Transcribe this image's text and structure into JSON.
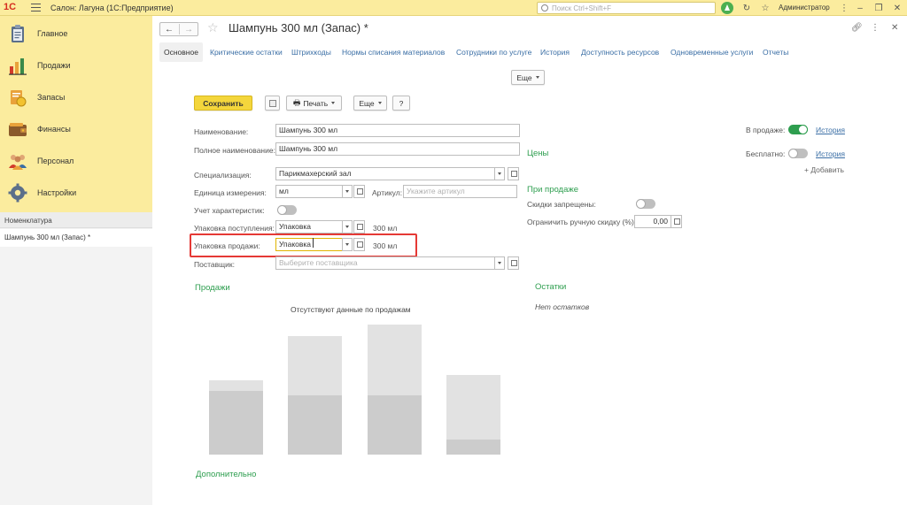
{
  "topbar": {
    "logo": "1С",
    "app_title": "Салон: Лагуна  (1С:Предприятие)",
    "search_placeholder": "Поиск Ctrl+Shift+F",
    "user": "Администратор"
  },
  "sidebar": {
    "items": [
      {
        "label": "Главное",
        "icon": "clipboard-icon"
      },
      {
        "label": "Продажи",
        "icon": "bar-chart-icon"
      },
      {
        "label": "Запасы",
        "icon": "coins-icon"
      },
      {
        "label": "Финансы",
        "icon": "wallet-icon"
      },
      {
        "label": "Персонал",
        "icon": "people-icon"
      },
      {
        "label": "Настройки",
        "icon": "gear-icon"
      }
    ],
    "section_title": "Номенклатура",
    "open_item": "Шампунь 300 мл (Запас) *"
  },
  "window": {
    "title": "Шампунь 300 мл (Запас) *"
  },
  "tabs": [
    "Основное",
    "Критические остатки",
    "Штрихкоды",
    "Нормы списания материалов",
    "Сотрудники по услуге",
    "История",
    "Доступность ресурсов",
    "Одновременные услуги",
    "Отчеты"
  ],
  "toolbar": {
    "more_top": "Еще",
    "save": "Сохранить",
    "print": "Печать",
    "more": "Еще",
    "help": "?"
  },
  "form": {
    "name_label": "Наименование:",
    "name_value": "Шампунь 300 мл",
    "fullname_label": "Полное наименование:",
    "fullname_value": "Шампунь 300 мл",
    "spec_label": "Специализация:",
    "spec_value": "Парикмахерский зал",
    "unit_label": "Единица измерения:",
    "unit_value": "мл",
    "article_label": "Артикул:",
    "article_placeholder": "Укажите артикул",
    "char_label": "Учет характеристик:",
    "pack_in_label": "Упаковка поступления:",
    "pack_in_value": "Упаковка",
    "pack_in_size": "300 мл",
    "pack_out_label": "Упаковка продажи:",
    "pack_out_value": "Упаковка",
    "pack_out_size": "300 мл",
    "supplier_label": "Поставщик:",
    "supplier_placeholder": "Выберите поставщика"
  },
  "right": {
    "on_sale_label": "В продаже:",
    "on_sale_history": "История",
    "free_label": "Бесплатно:",
    "free_history": "История",
    "add": "+ Добавить",
    "prices_title": "Цены",
    "on_sale_section": "При продаже",
    "discounts_label": "Скидки запрещены:",
    "manual_discount_label": "Ограничить ручную скидку (%):",
    "manual_discount_value": "0,00"
  },
  "sales": {
    "title": "Продажи",
    "empty_text": "Отсутствуют данные по продажам"
  },
  "stock": {
    "title": "Остатки",
    "empty_text": "Нет остатков"
  },
  "additional_title": "Дополнительно"
}
